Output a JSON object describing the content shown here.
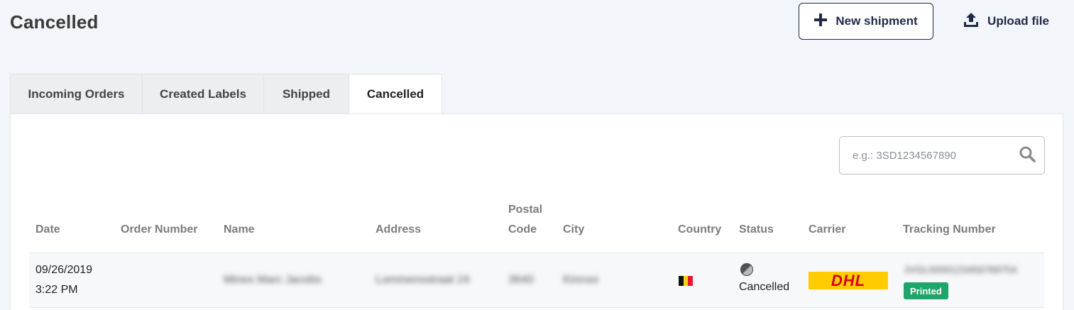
{
  "page": {
    "title": "Cancelled"
  },
  "actions": {
    "new_shipment_label": "New shipment",
    "upload_file_label": "Upload file"
  },
  "tabs": [
    {
      "label": "Incoming Orders"
    },
    {
      "label": "Created Labels"
    },
    {
      "label": "Shipped"
    },
    {
      "label": "Cancelled",
      "active": true
    }
  ],
  "search": {
    "placeholder": "e.g.: 3SD1234567890",
    "value": ""
  },
  "table": {
    "headers": {
      "date": "Date",
      "order_number": "Order Number",
      "name": "Name",
      "address": "Address",
      "postal_line1": "Postal",
      "postal_line2": "Code",
      "city": "City",
      "country": "Country",
      "status": "Status",
      "carrier": "Carrier",
      "tracking": "Tracking Number"
    },
    "rows": [
      {
        "date": "09/26/2019",
        "time": "3:22 PM",
        "order_number": "",
        "name": "Mines Marc Jacobs",
        "address": "Lommensstraat 24",
        "postal_code": "3640",
        "city": "Kinrooi",
        "country_flag": "belgium-flag",
        "status": "Cancelled",
        "carrier": "DHL",
        "tracking_number": "JVGL0000123456789754",
        "badge": "Printed"
      }
    ]
  },
  "colors": {
    "accent": "#1f2a44",
    "badge_green": "#1fa46b",
    "dhl_yellow": "#ffcc00",
    "dhl_red": "#d40511",
    "background": "#f2f5fa"
  },
  "icons": {
    "new_shipment": "plus-icon",
    "upload": "upload-icon",
    "search": "search-icon",
    "status": "cancelled-status-icon"
  }
}
